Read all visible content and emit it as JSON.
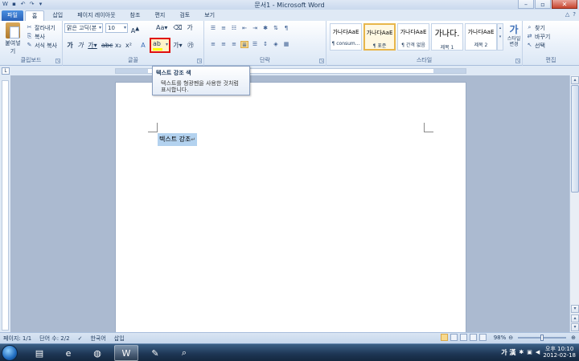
{
  "window": {
    "title": "문서1 - Microsoft Word"
  },
  "tabs": [
    {
      "label": "파일"
    },
    {
      "label": "홈"
    },
    {
      "label": "삽입"
    },
    {
      "label": "페이지 레이아웃"
    },
    {
      "label": "참조"
    },
    {
      "label": "편지"
    },
    {
      "label": "검토"
    },
    {
      "label": "보기"
    }
  ],
  "clipboard": {
    "paste_label": "붙여넣기",
    "cut_label": "잘라내기",
    "copy_label": "복사",
    "format_painter_label": "서식 복사",
    "group_label": "클립보드"
  },
  "font": {
    "name": "맑은 고딕(본",
    "size": "10",
    "group_label": "글꼴"
  },
  "paragraph": {
    "group_label": "단락"
  },
  "styles": {
    "items": [
      {
        "sample": "가나다AaE",
        "name": "¶ consum..."
      },
      {
        "sample": "가나다AaE",
        "name": "¶ 표준",
        "selected": true
      },
      {
        "sample": "가나다AaE",
        "name": "¶ 간격 없음"
      },
      {
        "sample": "가나다.",
        "name": "제목 1",
        "large": true
      },
      {
        "sample": "가나다AaE",
        "name": "제목 2"
      }
    ],
    "change_label_1": "스타일",
    "change_label_2": "변경",
    "group_label": "스타일"
  },
  "editing": {
    "find_label": "찾기",
    "replace_label": "바꾸기",
    "select_label": "선택",
    "group_label": "편집"
  },
  "tooltip": {
    "title": "텍스트 강조 색",
    "body_line1": "텍스트를 형광펜을 사용한 것처럼",
    "body_line2": "표시합니다."
  },
  "document": {
    "text": "텍스트 강조"
  },
  "statusbar": {
    "page": "페이지: 1/1",
    "words": "단어 수: 2/2",
    "language": "한국어",
    "mode": "삽입",
    "zoom": "98%"
  },
  "taskbar": {
    "ime": "가 漢",
    "time": "오후 10:10",
    "date": "2012-02-18"
  },
  "colors": {
    "highlight": "#ffff00",
    "selection": "#b3d2ef",
    "callout_border": "#e01010"
  }
}
